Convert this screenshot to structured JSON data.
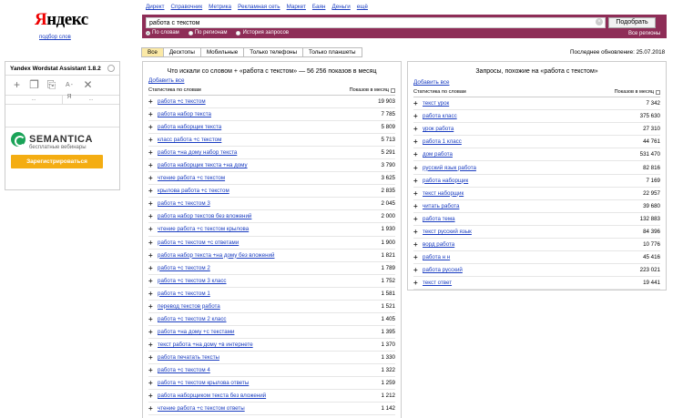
{
  "logo": {
    "first": "Я",
    "rest": "ндекс",
    "sub": "подбор слов"
  },
  "nav": [
    "Директ",
    "Справочник",
    "Метрика",
    "Рекламная сеть",
    "Маркет",
    "Баян",
    "Деньги",
    "ещё"
  ],
  "search": {
    "value": "работа с текстом",
    "button": "Подобрать",
    "all_regions": "Все регионы",
    "radios": [
      {
        "label": "По словам",
        "checked": true
      },
      {
        "label": "По регионам",
        "checked": false
      },
      {
        "label": "История запросов",
        "checked": false
      }
    ]
  },
  "tabs": [
    {
      "label": "Все",
      "active": true
    },
    {
      "label": "Десктопы",
      "active": false
    },
    {
      "label": "Мобильные",
      "active": false
    },
    {
      "label": "Только телефоны",
      "active": false
    },
    {
      "label": "Только планшеты",
      "active": false
    }
  ],
  "updated": "Последнее обновление: 25.07.2018",
  "sidebar": {
    "title": "Yandex Wordstat Assistant 1.8.2",
    "tool_text": "А-Я",
    "col_a": "...",
    "col_b": "...",
    "promo_name": "SEMANTICA",
    "promo_sub": "бесплатные вебинары",
    "promo_button": "Зарегистрироваться"
  },
  "left": {
    "title": "Что искали со словом  +  «работа с текстом» — 56 256 показов в месяц",
    "add_all": "Добавить все",
    "col_kw": "Статистика по словам",
    "col_cnt": "Показов в месяц",
    "rows": [
      [
        "работа +с текстом",
        "19 903"
      ],
      [
        "работа набор текста",
        "7 785"
      ],
      [
        "работа наборщик текста",
        "5 809"
      ],
      [
        "класс работа +с текстом",
        "5 713"
      ],
      [
        "работа +на дому набор текста",
        "5 291"
      ],
      [
        "работа наборщик текста +на дому",
        "3 790"
      ],
      [
        "чтение работа +с текстом",
        "3 625"
      ],
      [
        "крылова работа +с текстом",
        "2 835"
      ],
      [
        "работа +с текстом 3",
        "2 045"
      ],
      [
        "работа набор текстов без вложений",
        "2 000"
      ],
      [
        "чтение работа +с текстом крылова",
        "1 930"
      ],
      [
        "работа +с текстом +с ответами",
        "1 900"
      ],
      [
        "работа набор текста +на дому без вложений",
        "1 821"
      ],
      [
        "работа +с текстом 2",
        "1 789"
      ],
      [
        "работа +с текстом 3 класс",
        "1 752"
      ],
      [
        "работа +с текстом 1",
        "1 581"
      ],
      [
        "перевод текстов работа",
        "1 521"
      ],
      [
        "работа +с текстом 2 класс",
        "1 405"
      ],
      [
        "работа +на дому +с текстами",
        "1 395"
      ],
      [
        "текст работа +на дому +в интернете",
        "1 370"
      ],
      [
        "работа печатать тексты",
        "1 330"
      ],
      [
        "работа +с текстом 4",
        "1 322"
      ],
      [
        "работа +с текстом крылова ответы",
        "1 259"
      ],
      [
        "работа наборщиком текста без вложений",
        "1 212"
      ],
      [
        "чтение работа +с текстом ответы",
        "1 142"
      ]
    ]
  },
  "right": {
    "title": "Запросы, похожие на «работа с текстом»",
    "add_all": "Добавить все",
    "col_kw": "Статистика по словам",
    "col_cnt": "Показов в месяц",
    "rows": [
      [
        "текст урок",
        "7 342"
      ],
      [
        "работа класс",
        "375 630"
      ],
      [
        "урок работа",
        "27 310"
      ],
      [
        "работа 1 класс",
        "44 761"
      ],
      [
        "дом работа",
        "531 470"
      ],
      [
        "русский язык работа",
        "82 816"
      ],
      [
        "работа наборщик",
        "7 169"
      ],
      [
        "текст наборщик",
        "22 957"
      ],
      [
        "читать работа",
        "39 680"
      ],
      [
        "работа тема",
        "132 883"
      ],
      [
        "текст русский язык",
        "84 396"
      ],
      [
        "ворд работа",
        "10 776"
      ],
      [
        "работа н н",
        "45 416"
      ],
      [
        "работа русский",
        "223 021"
      ],
      [
        "текст ответ",
        "19 441"
      ]
    ]
  }
}
